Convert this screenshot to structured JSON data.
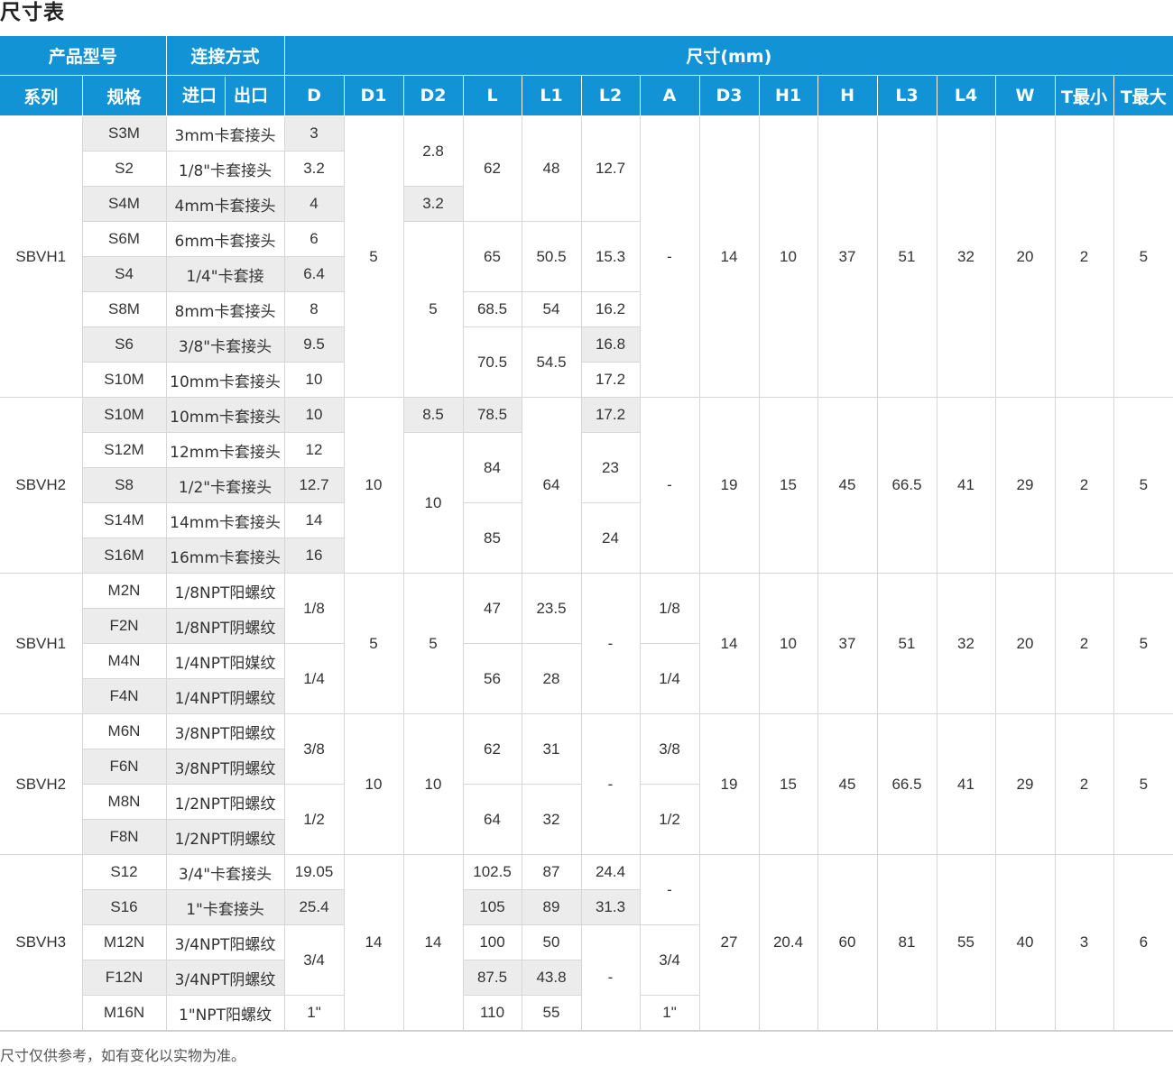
{
  "title": "尺寸表",
  "header": {
    "product_model": "产品型号",
    "connection": "连接方式",
    "dimensions": "尺寸(mm)",
    "series": "系列",
    "spec": "规格",
    "inlet": "进口",
    "outlet": "出口",
    "cols": [
      "D",
      "D1",
      "D2",
      "L",
      "L1",
      "L2",
      "A",
      "D3",
      "H1",
      "H",
      "L3",
      "L4",
      "W",
      "T最小",
      "T最大"
    ]
  },
  "groups": [
    {
      "series": "SBVH1",
      "rows": [
        {
          "spec": "S3M",
          "conn": "3mm卡套接头",
          "D": "3"
        },
        {
          "spec": "S2",
          "conn": "1/8\"卡套接头",
          "D": "3.2"
        },
        {
          "spec": "S4M",
          "conn": "4mm卡套接头",
          "D": "4"
        },
        {
          "spec": "S6M",
          "conn": "6mm卡套接头",
          "D": "6"
        },
        {
          "spec": "S4",
          "conn": "1/4\"卡套接",
          "D": "6.4"
        },
        {
          "spec": "S8M",
          "conn": "8mm卡套接头",
          "D": "8"
        },
        {
          "spec": "S6",
          "conn": "3/8\"卡套接头",
          "D": "9.5"
        },
        {
          "spec": "S10M",
          "conn": "10mm卡套接头",
          "D": "10"
        }
      ],
      "D1": "5",
      "D2": [
        "2.8",
        "3.2",
        "5"
      ],
      "L": [
        "62",
        "65",
        "68.5",
        "70.5"
      ],
      "L1": [
        "48",
        "50.5",
        "54",
        "54.5"
      ],
      "L2": [
        "12.7",
        "15.3",
        "16.2",
        "16.8",
        "17.2"
      ],
      "A": "-",
      "D3": "14",
      "H1": "10",
      "H": "37",
      "L3": "51",
      "L4": "32",
      "W": "20",
      "Tmin": "2",
      "Tmax": "5"
    },
    {
      "series": "SBVH2",
      "rows": [
        {
          "spec": "S10M",
          "conn": "10mm卡套接头",
          "D": "10"
        },
        {
          "spec": "S12M",
          "conn": "12mm卡套接头",
          "D": "12"
        },
        {
          "spec": "S8",
          "conn": "1/2\"卡套接头",
          "D": "12.7"
        },
        {
          "spec": "S14M",
          "conn": "14mm卡套接头",
          "D": "14"
        },
        {
          "spec": "S16M",
          "conn": "16mm卡套接头",
          "D": "16"
        }
      ],
      "D1": "10",
      "D2": [
        "8.5",
        "10"
      ],
      "L": [
        "78.5",
        "84",
        "85"
      ],
      "L1": "64",
      "L2": [
        "17.2",
        "23",
        "24"
      ],
      "A": "-",
      "D3": "19",
      "H1": "15",
      "H": "45",
      "L3": "66.5",
      "L4": "41",
      "W": "29",
      "Tmin": "2",
      "Tmax": "5"
    },
    {
      "series": "SBVH1",
      "rows": [
        {
          "spec": "M2N",
          "conn": "1/8NPT阳螺纹"
        },
        {
          "spec": "F2N",
          "conn": "1/8NPT阴螺纹"
        },
        {
          "spec": "M4N",
          "conn": "1/4NPT阳媒纹"
        },
        {
          "spec": "F4N",
          "conn": "1/4NPT阴螺纹"
        }
      ],
      "D": [
        "1/8",
        "1/4"
      ],
      "D1": "5",
      "D2": "5",
      "L": [
        "47",
        "56"
      ],
      "L1": [
        "23.5",
        "28"
      ],
      "L2": "-",
      "A": [
        "1/8",
        "1/4"
      ],
      "D3": "14",
      "H1": "10",
      "H": "37",
      "L3": "51",
      "L4": "32",
      "W": "20",
      "Tmin": "2",
      "Tmax": "5"
    },
    {
      "series": "SBVH2",
      "rows": [
        {
          "spec": "M6N",
          "conn": "3/8NPT阳螺纹"
        },
        {
          "spec": "F6N",
          "conn": "3/8NPT阴螺纹"
        },
        {
          "spec": "M8N",
          "conn": "1/2NPT阳螺纹"
        },
        {
          "spec": "F8N",
          "conn": "1/2NPT阴螺纹"
        }
      ],
      "D": [
        "3/8",
        "1/2"
      ],
      "D1": "10",
      "D2": "10",
      "L": [
        "62",
        "64"
      ],
      "L1": [
        "31",
        "32"
      ],
      "L2": "-",
      "A": [
        "3/8",
        "1/2"
      ],
      "D3": "19",
      "H1": "15",
      "H": "45",
      "L3": "66.5",
      "L4": "41",
      "W": "29",
      "Tmin": "2",
      "Tmax": "5"
    },
    {
      "series": "SBVH3",
      "rows": [
        {
          "spec": "S12",
          "conn": "3/4\"卡套接头",
          "D": "19.05",
          "L": "102.5",
          "L1": "87",
          "L2": "24.4"
        },
        {
          "spec": "S16",
          "conn": "1\"卡套接头",
          "D": "25.4",
          "L": "105",
          "L1": "89",
          "L2": "31.3"
        },
        {
          "spec": "M12N",
          "conn": "3/4NPT阳螺纹",
          "L": "100",
          "L1": "50"
        },
        {
          "spec": "F12N",
          "conn": "3/4NPT阴螺纹",
          "L": "87.5",
          "L1": "43.8"
        },
        {
          "spec": "M16N",
          "conn": "1\"NPT阳螺纹",
          "D": "1\"",
          "L": "110",
          "L1": "55"
        }
      ],
      "D_merged": "3/4",
      "D1": "14",
      "D2": "14",
      "L2_merged": "-",
      "A": [
        "-",
        "3/4",
        "1\""
      ],
      "D3": "27",
      "H1": "20.4",
      "H": "60",
      "L3": "81",
      "L4": "55",
      "W": "40",
      "Tmin": "3",
      "Tmax": "6"
    }
  ],
  "footnote": "尺寸仅供参考，如有变化以实物为准。"
}
